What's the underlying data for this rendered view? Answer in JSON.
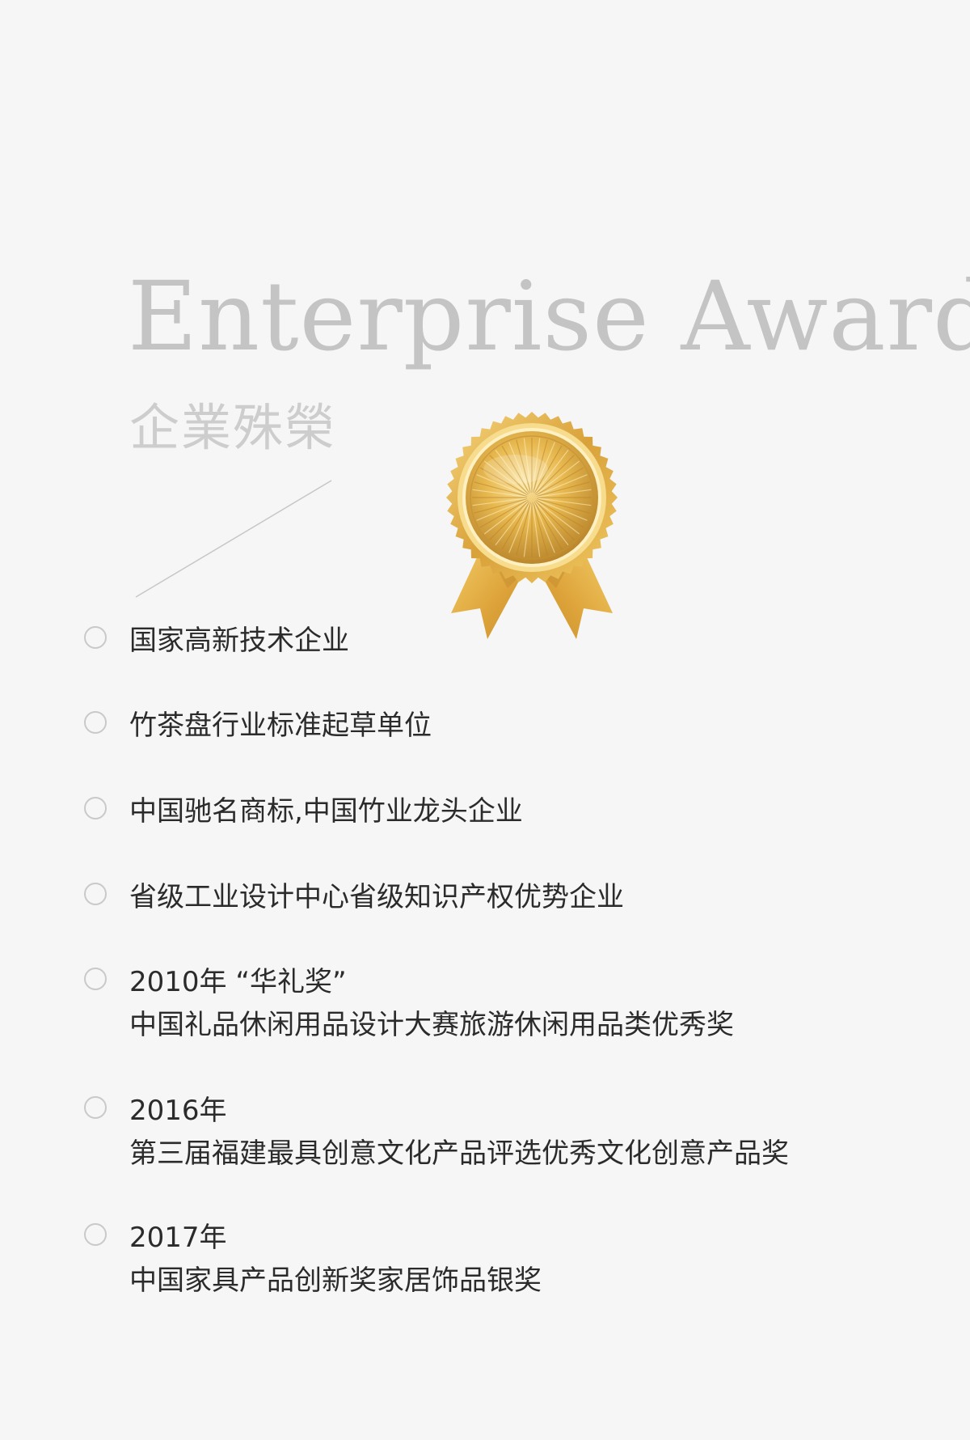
{
  "header": {
    "title_en": "Enterprise Award",
    "title_cn": "企業殊榮"
  },
  "colors": {
    "background": "#f6f6f6",
    "title": "#c4c4c4",
    "text": "#2b2b2b",
    "bullet_ring": "#c9c9c9",
    "medal_gold": "#e2b043",
    "ribbon_gold": "#e7b847"
  },
  "medal": {
    "icon": "gold-award-medal-icon"
  },
  "awards": [
    {
      "line1": "国家高新技术企业",
      "line2": ""
    },
    {
      "line1": "竹茶盘行业标准起草单位",
      "line2": ""
    },
    {
      "line1": "中国驰名商标,中国竹业龙头企业",
      "line2": ""
    },
    {
      "line1": "省级工业设计中心省级知识产权优势企业",
      "line2": ""
    },
    {
      "line1": "2010年 “华礼奖”",
      "line2": "中国礼品休闲用品设计大赛旅游休闲用品类优秀奖"
    },
    {
      "line1": "2016年",
      "line2": "第三届福建最具创意文化产品评选优秀文化创意产品奖"
    },
    {
      "line1": "2017年",
      "line2": "中国家具产品创新奖家居饰品银奖"
    }
  ]
}
